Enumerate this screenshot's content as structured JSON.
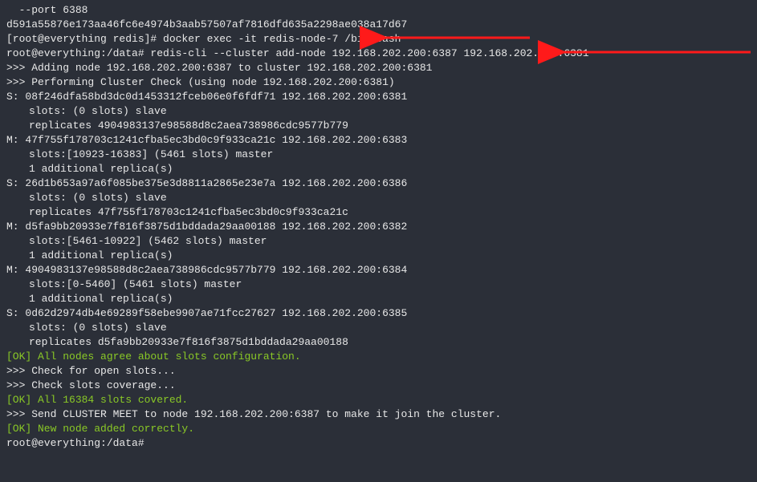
{
  "lines": [
    {
      "cls": "white",
      "text": "  --port 6388"
    },
    {
      "cls": "white",
      "text": "d591a55876e173aa46fc6e4974b3aab57507af7816dfd635a2298ae038a17d67"
    },
    {
      "cls": "white",
      "text": "[root@everything redis]# docker exec -it redis-node-7 /bin/bash"
    },
    {
      "cls": "white",
      "text": "root@everything:/data# redis-cli --cluster add-node 192.168.202.200:6387 192.168.202.200:6381"
    },
    {
      "cls": "white",
      "text": ">>> Adding node 192.168.202.200:6387 to cluster 192.168.202.200:6381"
    },
    {
      "cls": "white",
      "text": ">>> Performing Cluster Check (using node 192.168.202.200:6381)"
    },
    {
      "cls": "white",
      "text": "S: 08f246dfa58bd3dc0d1453312fceb06e0f6fdf71 192.168.202.200:6381"
    },
    {
      "cls": "white indent",
      "text": "slots: (0 slots) slave"
    },
    {
      "cls": "white indent",
      "text": "replicates 4904983137e98588d8c2aea738986cdc9577b779"
    },
    {
      "cls": "white",
      "text": "M: 47f755f178703c1241cfba5ec3bd0c9f933ca21c 192.168.202.200:6383"
    },
    {
      "cls": "white indent",
      "text": "slots:[10923-16383] (5461 slots) master"
    },
    {
      "cls": "white indent",
      "text": "1 additional replica(s)"
    },
    {
      "cls": "white",
      "text": "S: 26d1b653a97a6f085be375e3d8811a2865e23e7a 192.168.202.200:6386"
    },
    {
      "cls": "white indent",
      "text": "slots: (0 slots) slave"
    },
    {
      "cls": "white indent",
      "text": "replicates 47f755f178703c1241cfba5ec3bd0c9f933ca21c"
    },
    {
      "cls": "white",
      "text": "M: d5fa9bb20933e7f816f3875d1bddada29aa00188 192.168.202.200:6382"
    },
    {
      "cls": "white indent",
      "text": "slots:[5461-10922] (5462 slots) master"
    },
    {
      "cls": "white indent",
      "text": "1 additional replica(s)"
    },
    {
      "cls": "white",
      "text": "M: 4904983137e98588d8c2aea738986cdc9577b779 192.168.202.200:6384"
    },
    {
      "cls": "white indent",
      "text": "slots:[0-5460] (5461 slots) master"
    },
    {
      "cls": "white indent",
      "text": "1 additional replica(s)"
    },
    {
      "cls": "white",
      "text": "S: 0d62d2974db4e69289f58ebe9907ae71fcc27627 192.168.202.200:6385"
    },
    {
      "cls": "white indent",
      "text": "slots: (0 slots) slave"
    },
    {
      "cls": "white indent",
      "text": "replicates d5fa9bb20933e7f816f3875d1bddada29aa00188"
    },
    {
      "cls": "green",
      "text": "[OK] All nodes agree about slots configuration."
    },
    {
      "cls": "white",
      "text": ">>> Check for open slots..."
    },
    {
      "cls": "white",
      "text": ">>> Check slots coverage..."
    },
    {
      "cls": "green",
      "text": "[OK] All 16384 slots covered."
    },
    {
      "cls": "white",
      "text": ">>> Send CLUSTER MEET to node 192.168.202.200:6387 to make it join the cluster."
    },
    {
      "cls": "green",
      "text": "[OK] New node added correctly."
    },
    {
      "cls": "white",
      "text": "root@everything:/data#"
    }
  ],
  "arrows": {
    "color": "#ff1a1a"
  }
}
